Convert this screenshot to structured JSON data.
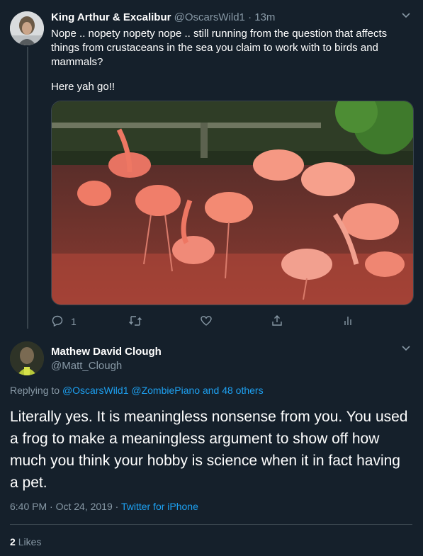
{
  "tweet1": {
    "author_name": "King Arthur & Excalibur",
    "handle": "@OscarsWild1",
    "separator": "·",
    "time": "13m",
    "text": "Nope .. nopety nopety nope .. still running from the question that affects things from crustaceans in the sea you claim to work with to birds and mammals?",
    "text2": "Here yah go!!",
    "reply_count": "1"
  },
  "tweet2": {
    "author_name": "Mathew David Clough",
    "handle": "@Matt_Clough",
    "replying_prefix": "Replying to",
    "replying_users": "@OscarsWild1 @ZombiePiano and 48 others",
    "text": "Literally yes. It is meaningless nonsense from you. You used a frog to make a meaningless argument to show off how much you think your hobby is science when it in fact having a pet.",
    "timestamp": "6:40 PM · Oct 24, 2019 ·",
    "source": "Twitter for iPhone",
    "likes_count": "2",
    "likes_label": "Likes"
  },
  "icons": [
    "reply-icon",
    "retweet-icon",
    "like-icon",
    "share-icon",
    "analytics-icon",
    "chevron-down-icon"
  ],
  "colors": {
    "background": "#15202b",
    "muted": "#8899a6",
    "accent": "#1da1f2",
    "border": "#38444d"
  }
}
